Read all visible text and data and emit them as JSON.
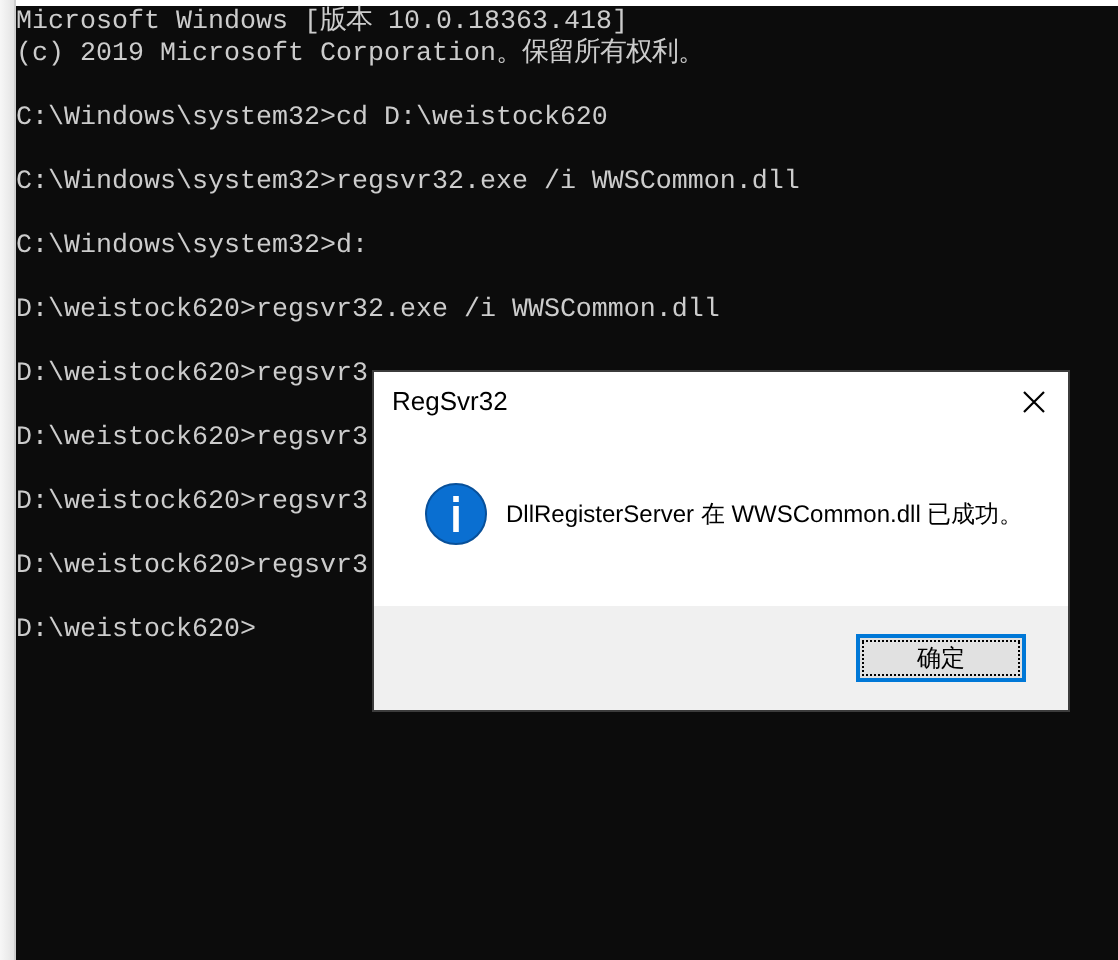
{
  "console": {
    "blocks": [
      [
        "Microsoft Windows [版本 10.0.18363.418]",
        "(c) 2019 Microsoft Corporation。保留所有权利。"
      ],
      [
        "C:\\Windows\\system32>cd D:\\weistock620"
      ],
      [
        "C:\\Windows\\system32>regsvr32.exe /i WWSCommon.dll"
      ],
      [
        "C:\\Windows\\system32>d:"
      ],
      [
        "D:\\weistock620>regsvr32.exe /i WWSCommon.dll"
      ],
      [
        "D:\\weistock620>regsvr3"
      ],
      [
        "D:\\weistock620>regsvr3"
      ],
      [
        "D:\\weistock620>regsvr3"
      ],
      [
        "D:\\weistock620>regsvr3"
      ],
      [
        "D:\\weistock620>"
      ]
    ]
  },
  "dialog": {
    "title": "RegSvr32",
    "message": "DllRegisterServer 在 WWSCommon.dll 已成功。",
    "button": {
      "label": "确定",
      "focused": true
    }
  }
}
